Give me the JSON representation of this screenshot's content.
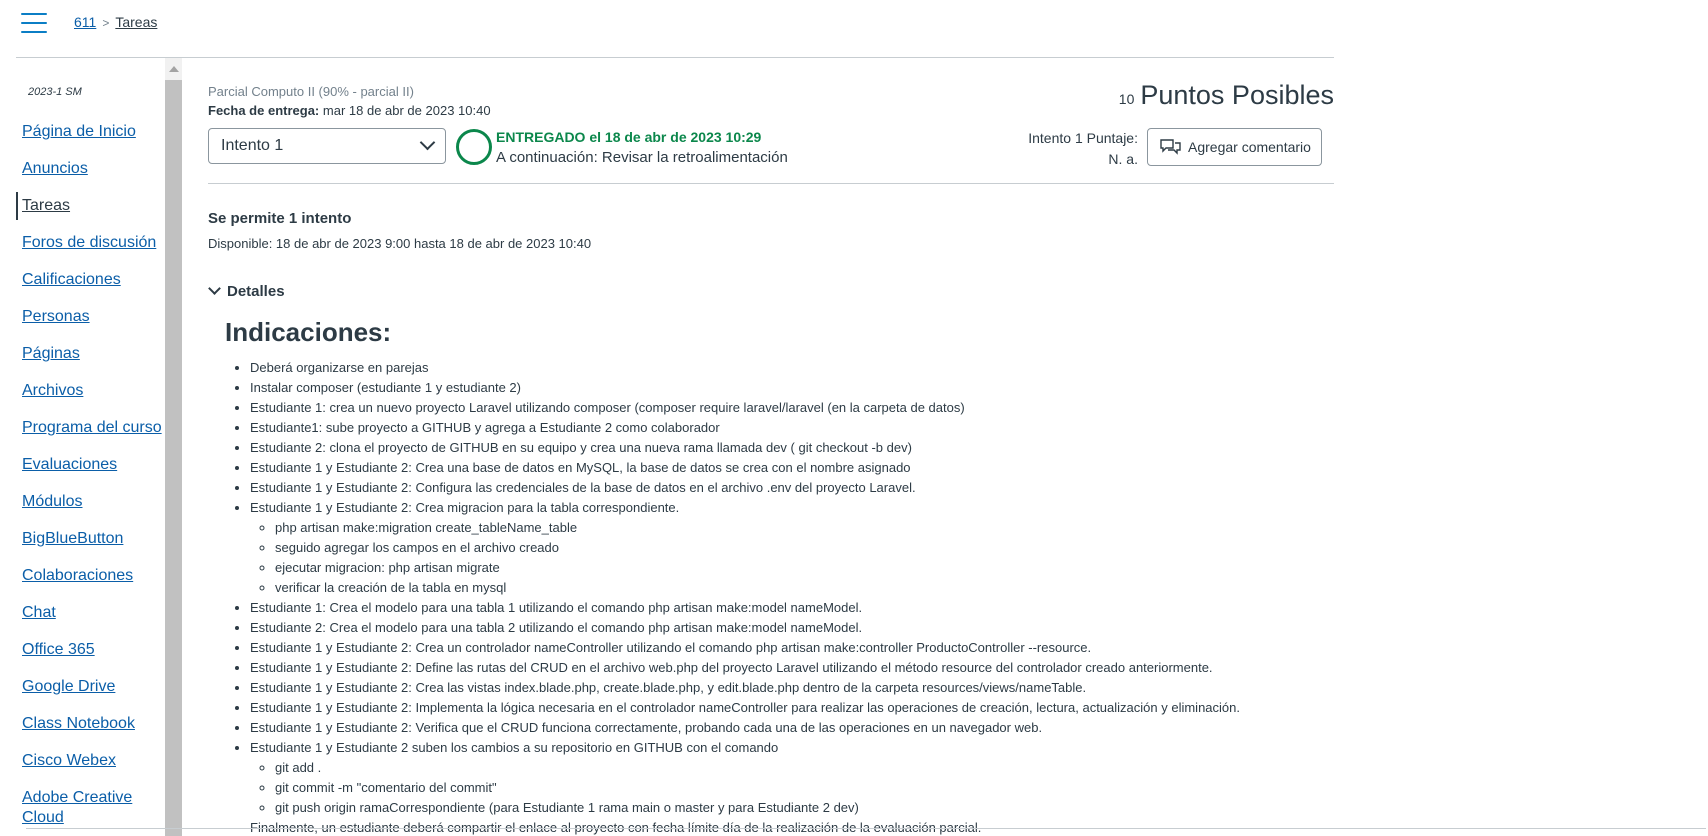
{
  "breadcrumb": {
    "course": "611",
    "separator": ">",
    "current": "Tareas"
  },
  "sidebar": {
    "term": "2023-1 SM",
    "items": [
      {
        "label": "Página de Inicio"
      },
      {
        "label": "Anuncios"
      },
      {
        "label": "Tareas",
        "active": true
      },
      {
        "label": "Foros de discusión"
      },
      {
        "label": "Calificaciones"
      },
      {
        "label": "Personas"
      },
      {
        "label": "Páginas"
      },
      {
        "label": "Archivos"
      },
      {
        "label": "Programa del curso"
      },
      {
        "label": "Evaluaciones"
      },
      {
        "label": "Módulos"
      },
      {
        "label": "BigBlueButton"
      },
      {
        "label": "Colaboraciones"
      },
      {
        "label": "Chat"
      },
      {
        "label": "Office 365"
      },
      {
        "label": "Google Drive"
      },
      {
        "label": "Class Notebook"
      },
      {
        "label": "Cisco Webex"
      },
      {
        "label": "Adobe Creative Cloud"
      }
    ]
  },
  "assignment": {
    "course_name": "Parcial Computo II (90% - parcial II)",
    "due_label": "Fecha de entrega:",
    "due_value": "mar 18 de abr de 2023 10:40",
    "points_value": "10",
    "points_label": "Puntos Posibles",
    "attempt_select": "Intento 1",
    "submitted_text": "ENTREGADO el 18 de abr de 2023 10:29",
    "next_text": "A continuación: Revisar la retroalimentación",
    "score_label": "Intento 1 Puntaje:",
    "score_value": "N. a.",
    "comment_button": "Agregar comentario",
    "attempts_allowed": "Se permite 1 intento",
    "available": "Disponible: 18 de abr de 2023 9:00 hasta 18 de abr de 2023 10:40",
    "details_label": "Detalles"
  },
  "instructions": {
    "heading": "Indicaciones:",
    "items": [
      "Deberá organizarse en parejas",
      "Instalar composer (estudiante 1 y estudiante 2)",
      "Estudiante 1: crea un nuevo proyecto Laravel utilizando composer (composer require laravel/laravel (en la carpeta de datos)",
      "Estudiante1: sube proyecto a GITHUB y agrega a Estudiante 2 como colaborador",
      "Estudiante 2: clona el proyecto de GITHUB en su equipo y crea una nueva rama llamada dev ( git checkout -b dev)",
      "Estudiante 1 y Estudiante 2: Crea una base de datos en MySQL, la base de datos se crea con el nombre asignado",
      "Estudiante 1 y Estudiante 2:  Configura las credenciales de la base de datos en el archivo .env del proyecto Laravel.",
      "Estudiante 1 y Estudiante 2:  Crea migracion para la tabla correspondiente."
    ],
    "subitems_1": [
      "php artisan make:migration create_tableName_table",
      "seguido agregar los campos en el archivo creado",
      "ejecutar migracion: php artisan migrate",
      "verificar la creación de la tabla en mysql"
    ],
    "items_2": [
      "Estudiante 1: Crea el modelo para una tabla 1 utilizando el comando php artisan make:model nameModel.",
      "Estudiante 2: Crea el modelo para una tabla 2 utilizando el comando php artisan make:model nameModel.",
      "Estudiante 1 y Estudiante 2: Crea un controlador nameController utilizando el comando php artisan make:controller ProductoController --resource.",
      "Estudiante 1 y Estudiante 2: Define las rutas del CRUD en el archivo web.php del proyecto Laravel utilizando el método resource del controlador creado anteriormente.",
      "Estudiante 1 y Estudiante 2:  Crea las vistas index.blade.php, create.blade.php, y edit.blade.php  dentro de la carpeta resources/views/nameTable.",
      "Estudiante 1 y Estudiante 2:  Implementa la lógica necesaria en el controlador nameController para realizar las operaciones de creación, lectura, actualización y eliminación.",
      "Estudiante 1 y Estudiante 2: Verifica que el CRUD funciona correctamente, probando cada una de las operaciones en un navegador web.",
      "Estudiante 1 y Estudiante 2 suben los cambios a su repositorio en GITHUB con el comando"
    ],
    "subitems_2": [
      "git add .",
      "git commit -m \"comentario del commit\"",
      "git push origin ramaCorrespondiente (para Estudiante 1 rama main o master y para Estudiante 2 dev)"
    ],
    "final": "Finalmente, un estudiante deberá compartir el enlace al proyecto con fecha límite día de la realización de la evaluación parcial."
  }
}
